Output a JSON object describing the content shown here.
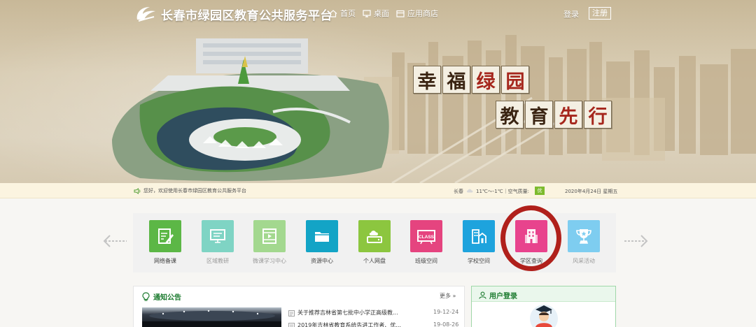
{
  "header": {
    "site_title": "长春市绿园区教育公共服务平台",
    "nav": [
      {
        "label": "首页",
        "icon": "home-icon"
      },
      {
        "label": "桌面",
        "icon": "monitor-icon"
      },
      {
        "label": "应用商店",
        "icon": "store-icon"
      }
    ],
    "login_label": "登录",
    "register_label": "注册"
  },
  "banner": {
    "slogan_line1": [
      "幸",
      "福",
      "绿",
      "园"
    ],
    "slogan_line2": [
      "教",
      "育",
      "先",
      "行"
    ]
  },
  "info_bar": {
    "welcome_text": "您好，欢迎使用长春市绿园区教育公共服务平台",
    "city": "长春",
    "weather": "11℃～-1℃｜空气质量:",
    "aqi": "优",
    "date": "2020年4月24日 星期五"
  },
  "apps": [
    {
      "label": "网络备课",
      "icon": "lesson-plan-icon",
      "color": "#5cb746"
    },
    {
      "label": "区域教研",
      "icon": "research-screen-icon",
      "color": "#7fd4c4"
    },
    {
      "label": "微课学习中心",
      "icon": "video-play-icon",
      "color": "#a3d88f"
    },
    {
      "label": "资源中心",
      "icon": "folder-icon",
      "color": "#13a4c6"
    },
    {
      "label": "个人网盘",
      "icon": "cloud-drive-icon",
      "color": "#8cc63f"
    },
    {
      "label": "班级空间",
      "icon": "class-board-icon",
      "color": "#e5447f"
    },
    {
      "label": "学校空间",
      "icon": "school-building-icon",
      "color": "#1ea3dd"
    },
    {
      "label": "学区查询",
      "icon": "district-building-icon",
      "color": "#e8438d"
    },
    {
      "label": "风采活动",
      "icon": "trophy-icon",
      "color": "#7ecdf0"
    }
  ],
  "colors": {
    "highlight": "#b0201b",
    "brand_green": "#1a7a2d"
  },
  "notice": {
    "title": "通知公告",
    "more_label": "更多",
    "items": [
      {
        "title": "关于推荐吉林省第七批中小学正高级教...",
        "date": "19-12-24"
      },
      {
        "title": "2019年吉林省教育系统先进工作者、优...",
        "date": "19-08-26"
      }
    ]
  },
  "login_panel": {
    "title": "用户登录"
  }
}
